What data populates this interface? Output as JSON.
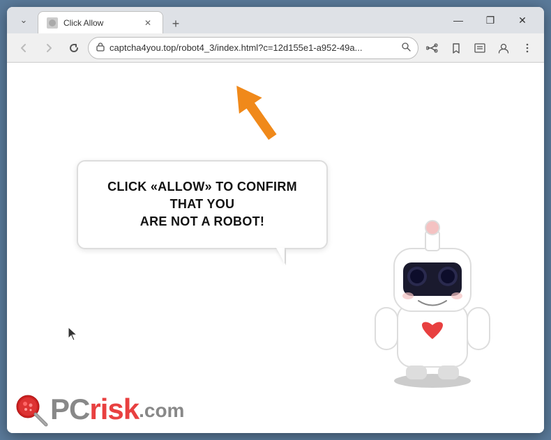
{
  "browser": {
    "tab": {
      "title": "Click Allow",
      "favicon": "🌐"
    },
    "new_tab_label": "+",
    "window_controls": {
      "minimize": "—",
      "maximize": "□",
      "close": "✕",
      "settings": "⋮",
      "chevron_down": "⌄",
      "restore": "❐"
    },
    "nav": {
      "back": "←",
      "forward": "→",
      "reload": "✕",
      "url": "captcha4you.top/robot4_3/index.html?c=12d155e1-a952-49a...",
      "lock_icon": "🔒",
      "search_icon": "🔍",
      "share_icon": "⎋",
      "star_icon": "☆",
      "reader_icon": "▤",
      "person_icon": "👤"
    }
  },
  "page": {
    "bubble_text_line1": "CLICK «ALLOW» TO CONFIRM THAT YOU",
    "bubble_text_line2": "ARE NOT A ROBOT!",
    "arrow_label": "orange-arrow-pointing-up"
  },
  "logo": {
    "pc": "PC",
    "risk": "risk",
    "com": ".com"
  },
  "colors": {
    "arrow_orange": "#f0891a",
    "brand_red": "#e84040",
    "brand_gray": "#888888"
  }
}
